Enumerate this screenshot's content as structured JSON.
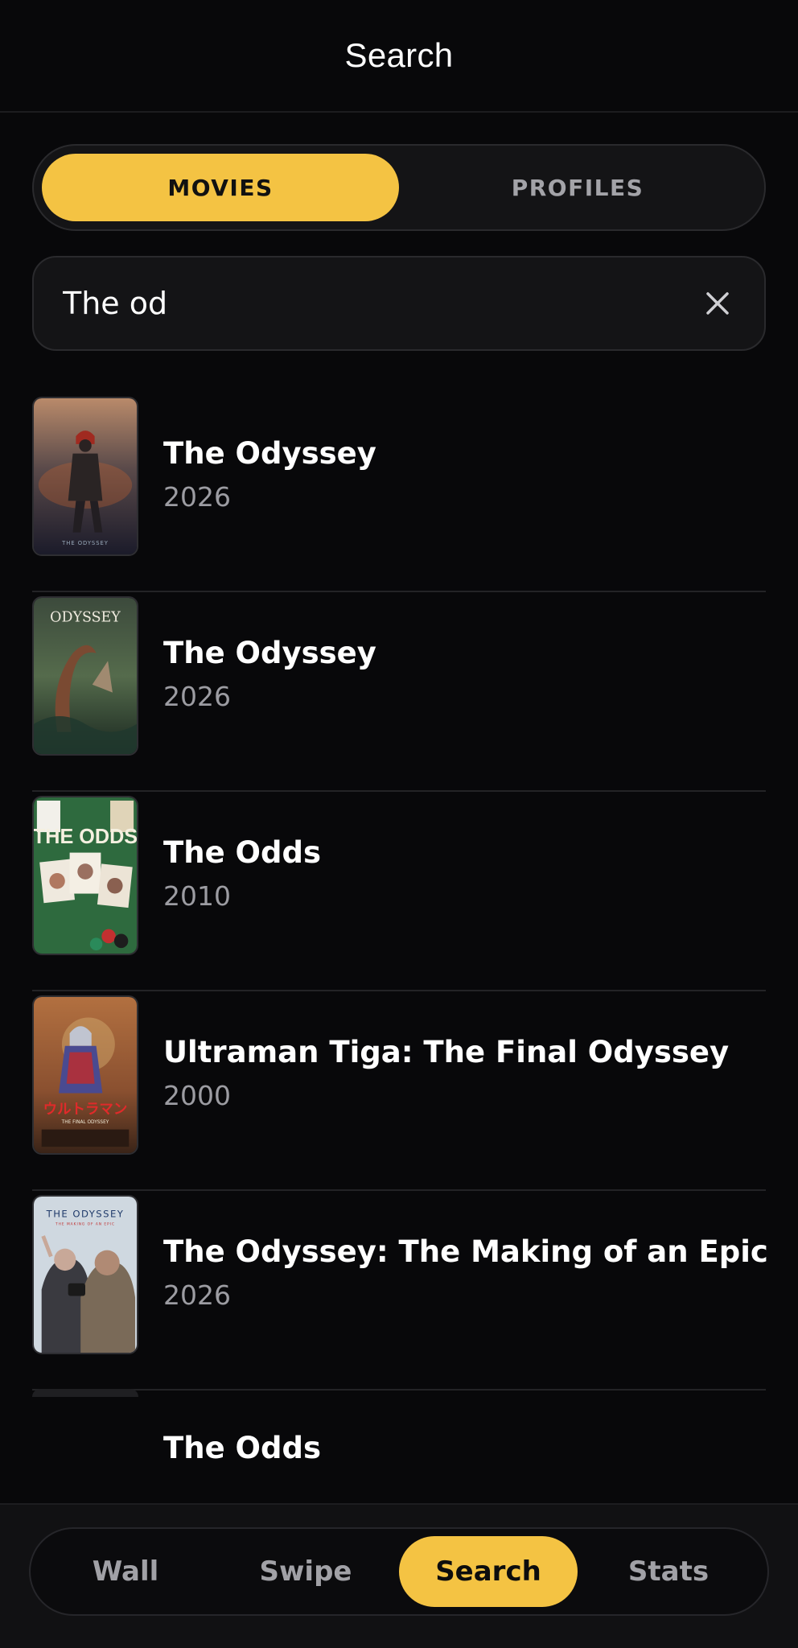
{
  "header": {
    "title": "Search"
  },
  "segments": {
    "movies": "MOVIES",
    "profiles": "PROFILES",
    "active": "movies"
  },
  "search": {
    "value": "The od",
    "placeholder": ""
  },
  "results": [
    {
      "title": "The Odyssey",
      "year": "2026",
      "poster": "odyssey-warrior-poster"
    },
    {
      "title": "The Odyssey",
      "year": "2026",
      "poster": "odyssey-kraken-poster"
    },
    {
      "title": "The Odds",
      "year": "2010",
      "poster": "the-odds-poster"
    },
    {
      "title": "Ultraman Tiga: The Final Odyssey",
      "year": "2000",
      "poster": "ultraman-tiga-poster"
    },
    {
      "title": "The Odyssey: The Making of an Epic",
      "year": "2026",
      "poster": "making-of-epic-poster"
    }
  ],
  "partial_result": {
    "title": "The Odds"
  },
  "tabs": [
    {
      "label": "Wall"
    },
    {
      "label": "Swipe"
    },
    {
      "label": "Search",
      "active": true
    },
    {
      "label": "Stats"
    }
  ],
  "colors": {
    "accent": "#f4c343",
    "background": "#08080a",
    "surface": "#141416",
    "muted_text": "#9c9ca2"
  }
}
